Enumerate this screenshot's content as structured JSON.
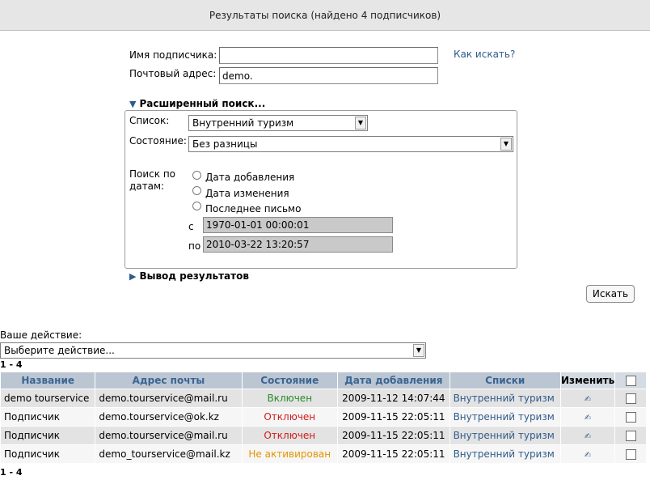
{
  "title": "Результаты поиска (найдено 4 подписчиков)",
  "search": {
    "name_label": "Имя подписчика:",
    "name_value": "",
    "email_label": "Почтовый адрес:",
    "email_value": "demo.",
    "help_link": "Как искать?"
  },
  "advanced": {
    "header": "Расширенный поиск...",
    "list_label": "Список:",
    "list_value": "Внутренний туризм",
    "state_label": "Состояние:",
    "state_value": "Без разницы",
    "date_label_line1": "Поиск по",
    "date_label_line2": "датам:",
    "date_options": [
      "Дата добавления",
      "Дата изменения",
      "Последнее письмо"
    ],
    "from_label": "с",
    "from_value": "1970-01-01 00:00:01",
    "to_label": "по",
    "to_value": "2010-03-22 13:20:57"
  },
  "output": {
    "header": "Вывод результатов"
  },
  "search_button": "Искать",
  "action": {
    "label": "Ваше действие:",
    "select_value": "Выберите действие..."
  },
  "pagination": {
    "range_top": "1 - 4",
    "range_bottom": "1 - 4"
  },
  "table": {
    "headers": {
      "name": "Название",
      "email": "Адрес почты",
      "state": "Состояние",
      "date_added": "Дата добавления",
      "lists": "Списки",
      "edit": "Изменить"
    },
    "rows": [
      {
        "name": "demo tourservice",
        "email": "demo.tourservice@mail.ru",
        "state": "Включен",
        "state_kind": "on",
        "date": "2009-11-12 14:07:44",
        "list": "Внутренний туризм"
      },
      {
        "name": "Подписчик",
        "email": "demo.tourservice@ok.kz",
        "state": "Отключен",
        "state_kind": "off",
        "date": "2009-11-15 22:05:11",
        "list": "Внутренний туризм"
      },
      {
        "name": "Подписчик",
        "email": "demo.tourservice@mail.ru",
        "state": "Отключен",
        "state_kind": "off",
        "date": "2009-11-15 22:05:11",
        "list": "Внутренний туризм"
      },
      {
        "name": "Подписчик",
        "email": "demo_tourservice@mail.kz",
        "state": "Не активирован",
        "state_kind": "pending",
        "date": "2009-11-15 22:05:11",
        "list": "Внутренний туризм"
      }
    ]
  },
  "icons": {
    "edit": "pencil-icon",
    "dropdown": "chevron-down-icon",
    "section": "triangle-icon"
  },
  "colors": {
    "enabled": "#2a8a2a",
    "disabled": "#d01a1a",
    "pending": "#e59400",
    "link": "#2f5b8a",
    "header_bg": "#bcc6d3"
  }
}
